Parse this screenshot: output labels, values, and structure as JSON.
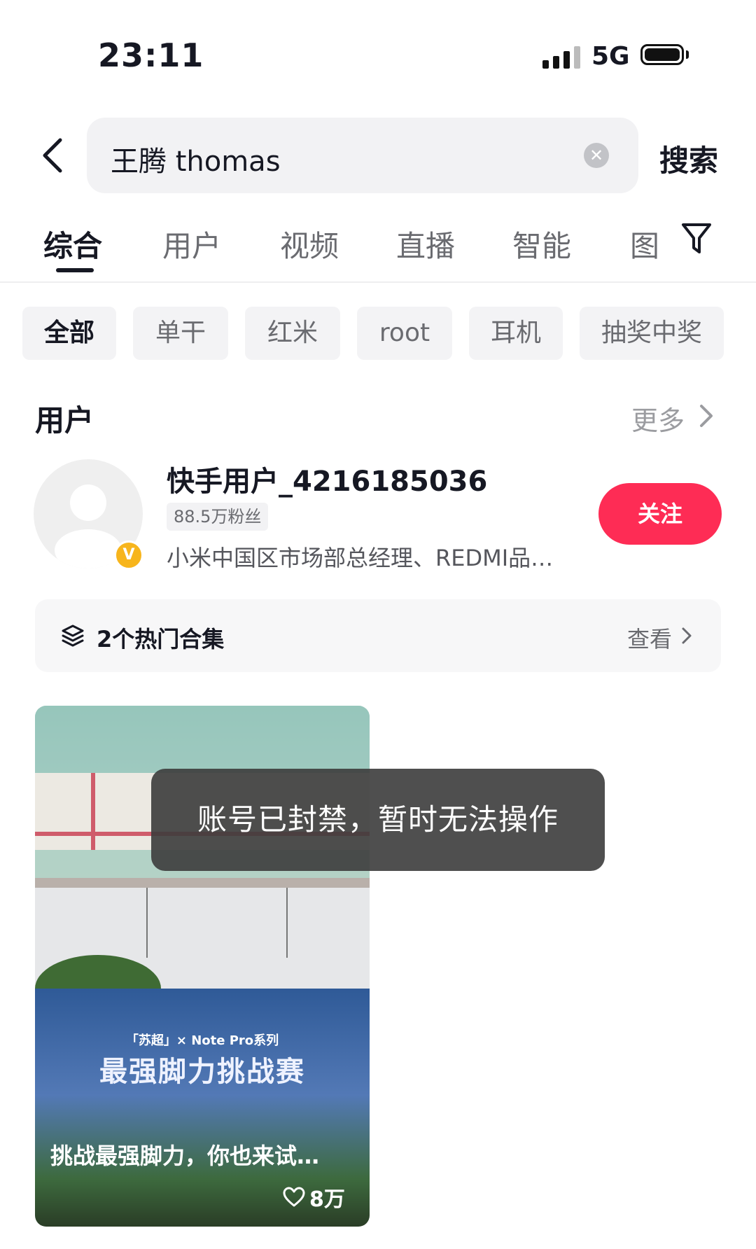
{
  "status_bar": {
    "time": "23:11",
    "network": "5G"
  },
  "search": {
    "query": "王腾 thomas",
    "button": "搜索"
  },
  "tabs": [
    {
      "label": "综合",
      "active": true
    },
    {
      "label": "用户"
    },
    {
      "label": "视频"
    },
    {
      "label": "直播"
    },
    {
      "label": "智能"
    },
    {
      "label": "图"
    }
  ],
  "chips": [
    {
      "label": "全部",
      "active": true
    },
    {
      "label": "单干"
    },
    {
      "label": "红米"
    },
    {
      "label": "root"
    },
    {
      "label": "耳机"
    },
    {
      "label": "抽奖中奖"
    }
  ],
  "user_section": {
    "title": "用户",
    "more": "更多",
    "user": {
      "name": "快手用户_4216185036",
      "fans": "88.5万粉丝",
      "bio": "小米中国区市场部总经理、REDMI品…",
      "follow": "关注",
      "badge": "V"
    }
  },
  "collection": {
    "text": "2个热门合集",
    "view": "查看"
  },
  "video_card": {
    "promo_small": "「苏超」× Note Pro系列",
    "promo_big": "最强脚力挑战赛",
    "caption": "挑战最强脚力，你也来试…",
    "likes": "8万"
  },
  "toast": "账号已封禁，暂时无法操作",
  "colors": {
    "accent": "#fe2c55",
    "badge": "#f7b51c"
  }
}
